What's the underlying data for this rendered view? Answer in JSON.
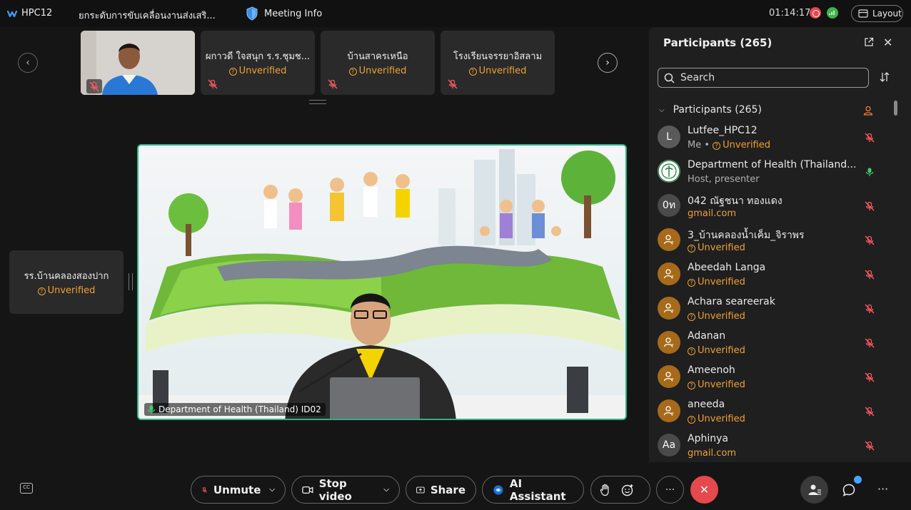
{
  "top_bar": {
    "app_name": "HPC12",
    "meeting_topic": "ยกระดับการขับเคลื่อนงานส่งเสริ...",
    "meeting_info_label": "Meeting Info",
    "timer": "01:14:17",
    "layout_label": "Layout"
  },
  "thumbnails": [
    {
      "name": "",
      "status": "",
      "muted": true,
      "has_video": true
    },
    {
      "name": "ผกาวดี ใจสนุก ร.ร.ชุมช...",
      "status": "Unverified",
      "muted": true
    },
    {
      "name": "บ้านสาครเหนือ",
      "status": "Unverified",
      "muted": true
    },
    {
      "name": "โรงเรียนจรรยาอิสลาม",
      "status": "Unverified",
      "muted": true
    }
  ],
  "side_tile": {
    "name": "รร.บ้านคลองสองปาก",
    "status": "Unverified"
  },
  "main_video": {
    "speaker_label": "Department of Health (Thailand) ID02"
  },
  "panel": {
    "title": "Participants (265)",
    "search_placeholder": "Search",
    "group_label": "Participants (265)",
    "participants": [
      {
        "name": "Lutfee_HPC12",
        "sub_prefix": "Me • ",
        "sub": "Unverified",
        "sub_type": "warn",
        "avatar": "L",
        "avatar_color": "#5a5a5a",
        "mic": "muted"
      },
      {
        "name": "Department of Health (Thailand...",
        "sub": "Host, presenter",
        "sub_type": "normal",
        "avatar": "",
        "avatar_color": "#e8f3ea",
        "mic": "on"
      },
      {
        "name": "042 ณัฐชนา ทองแดง",
        "sub": "gmail.com",
        "sub_type": "warn",
        "avatar": "0ท",
        "avatar_color": "#4a4a4a",
        "mic": "muted"
      },
      {
        "name": "3_บ้านคลองน้ำเค็ม_จิราพร",
        "sub": "Unverified",
        "sub_type": "warn",
        "avatar": "",
        "avatar_color": "#a66a1a",
        "mic": "muted"
      },
      {
        "name": "Abeedah Langa",
        "sub": "Unverified",
        "sub_type": "warn",
        "avatar": "",
        "avatar_color": "#a66a1a",
        "mic": "muted"
      },
      {
        "name": "Achara seareerak",
        "sub": "Unverified",
        "sub_type": "warn",
        "avatar": "",
        "avatar_color": "#a66a1a",
        "mic": "muted"
      },
      {
        "name": "Adanan",
        "sub": "Unverified",
        "sub_type": "warn",
        "avatar": "",
        "avatar_color": "#a66a1a",
        "mic": "muted"
      },
      {
        "name": "Ameenoh",
        "sub": "Unverified",
        "sub_type": "warn",
        "avatar": "",
        "avatar_color": "#a66a1a",
        "mic": "muted"
      },
      {
        "name": "aneeda",
        "sub": "Unverified",
        "sub_type": "warn",
        "avatar": "",
        "avatar_color": "#a66a1a",
        "mic": "muted"
      },
      {
        "name": "Aphinya",
        "sub": "gmail.com",
        "sub_type": "warn",
        "avatar": "Aa",
        "avatar_color": "#4a4a4a",
        "mic": "muted"
      }
    ]
  },
  "toolbar": {
    "unmute_label": "Unmute",
    "stop_video_label": "Stop video",
    "share_label": "Share",
    "ai_assistant_label": "AI Assistant",
    "more_label": "···"
  },
  "colors": {
    "accent_green": "#2fb287",
    "warning": "#f0a035",
    "leave_red": "#e5484d"
  }
}
